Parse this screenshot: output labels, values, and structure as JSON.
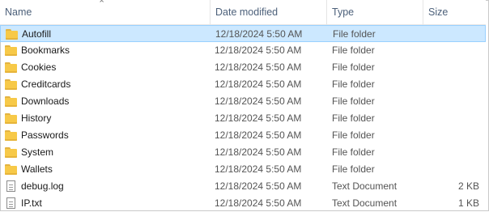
{
  "columns": {
    "name": "Name",
    "date": "Date modified",
    "type": "Type",
    "size": "Size"
  },
  "sort": {
    "column": "name",
    "icon": "chevron-up-icon"
  },
  "rows": [
    {
      "name": "Autofill",
      "date": "12/18/2024 5:50 AM",
      "type": "File folder",
      "size": "",
      "icon": "folder-icon",
      "selected": true
    },
    {
      "name": "Bookmarks",
      "date": "12/18/2024 5:50 AM",
      "type": "File folder",
      "size": "",
      "icon": "folder-icon"
    },
    {
      "name": "Cookies",
      "date": "12/18/2024 5:50 AM",
      "type": "File folder",
      "size": "",
      "icon": "folder-icon"
    },
    {
      "name": "Creditcards",
      "date": "12/18/2024 5:50 AM",
      "type": "File folder",
      "size": "",
      "icon": "folder-icon"
    },
    {
      "name": "Downloads",
      "date": "12/18/2024 5:50 AM",
      "type": "File folder",
      "size": "",
      "icon": "folder-icon"
    },
    {
      "name": "History",
      "date": "12/18/2024 5:50 AM",
      "type": "File folder",
      "size": "",
      "icon": "folder-icon"
    },
    {
      "name": "Passwords",
      "date": "12/18/2024 5:50 AM",
      "type": "File folder",
      "size": "",
      "icon": "folder-icon"
    },
    {
      "name": "System",
      "date": "12/18/2024 5:50 AM",
      "type": "File folder",
      "size": "",
      "icon": "folder-icon"
    },
    {
      "name": "Wallets",
      "date": "12/18/2024 5:50 AM",
      "type": "File folder",
      "size": "",
      "icon": "folder-icon"
    },
    {
      "name": "debug.log",
      "date": "12/18/2024 5:50 AM",
      "type": "Text Document",
      "size": "2 KB",
      "icon": "document-icon"
    },
    {
      "name": "IP.txt",
      "date": "12/18/2024 5:50 AM",
      "type": "Text Document",
      "size": "1 KB",
      "icon": "document-icon"
    }
  ],
  "colors": {
    "selection_bg": "#cce8ff",
    "selection_border": "#99d1ff",
    "folder": "#f7c948",
    "header_text": "#4c607a"
  }
}
